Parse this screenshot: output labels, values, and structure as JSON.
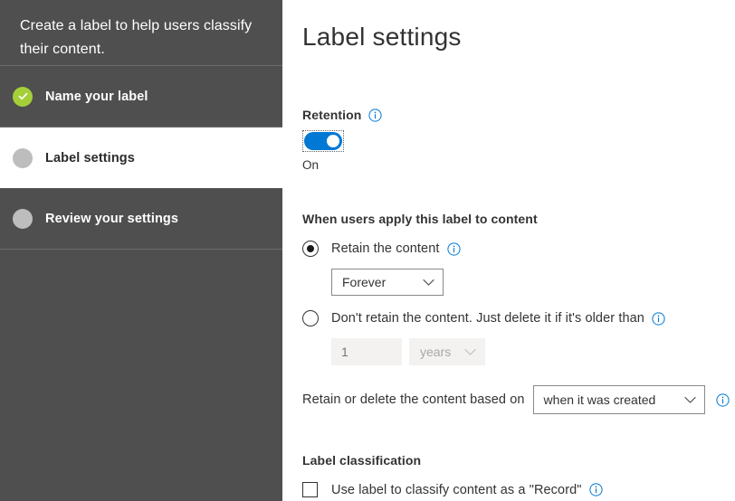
{
  "sidebar": {
    "intro": "Create a label to help users classify their content.",
    "steps": [
      {
        "label": "Name your label",
        "state": "completed",
        "icon": "check-circle-icon"
      },
      {
        "label": "Label settings",
        "state": "active",
        "icon": "step-dot-icon"
      },
      {
        "label": "Review your settings",
        "state": "pending",
        "icon": "step-dot-icon"
      }
    ]
  },
  "main": {
    "title": "Label settings",
    "retention": {
      "heading": "Retention",
      "info_icon": "info-icon",
      "toggle_state": "on",
      "toggle_state_label": "On"
    },
    "apply": {
      "heading": "When users apply this label to content",
      "option_retain": {
        "label": "Retain the content",
        "selected": true,
        "info_icon": "info-icon"
      },
      "retain_duration": {
        "value": "Forever",
        "disabled": false
      },
      "option_delete": {
        "label": "Don't retain the content. Just delete it if it's older than",
        "selected": false,
        "info_icon": "info-icon"
      },
      "delete_age_number": {
        "value": "1",
        "placeholder": "1",
        "disabled": true
      },
      "delete_age_unit": {
        "value": "years",
        "disabled": true
      },
      "based_on": {
        "label": "Retain or delete the content based on",
        "value": "when it was created",
        "info_icon": "info-icon"
      }
    },
    "classification": {
      "heading": "Label classification",
      "checkbox_label": "Use label to classify content as a \"Record\"",
      "checked": false,
      "info_icon": "info-icon"
    }
  },
  "colors": {
    "sidebar_bg": "#4f4f4f",
    "accent_blue": "#0078d4",
    "success_green": "#a4cf39",
    "text_dark": "#333333",
    "disabled_bg": "#f3f2f1"
  }
}
